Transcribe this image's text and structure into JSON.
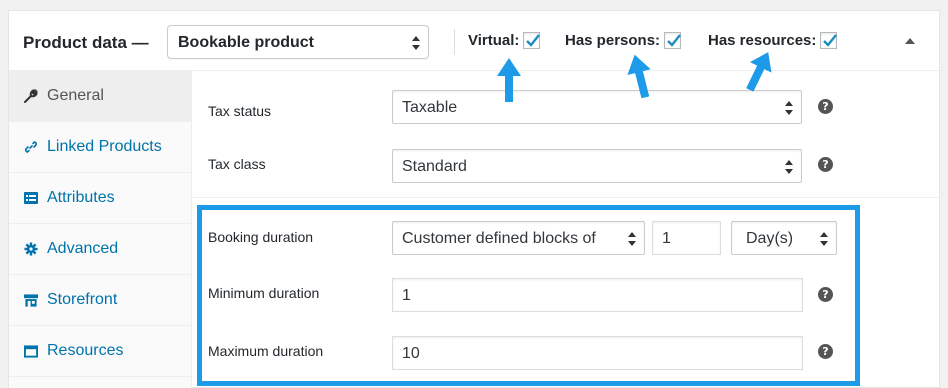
{
  "header": {
    "title": "Product data —",
    "product_type": "Bookable product",
    "options": [
      {
        "label": "Virtual:",
        "checked": true
      },
      {
        "label": "Has persons:",
        "checked": true
      },
      {
        "label": "Has resources:",
        "checked": true
      }
    ]
  },
  "sidebar": {
    "tabs": [
      {
        "label": "General",
        "icon": "wrench-icon",
        "active": true
      },
      {
        "label": "Linked Products",
        "icon": "link-icon",
        "active": false
      },
      {
        "label": "Attributes",
        "icon": "list-icon",
        "active": false
      },
      {
        "label": "Advanced",
        "icon": "gear-icon",
        "active": false
      },
      {
        "label": "Storefront",
        "icon": "store-icon",
        "active": false
      },
      {
        "label": "Resources",
        "icon": "window-icon",
        "active": false
      }
    ]
  },
  "general": {
    "tax_status": {
      "label": "Tax status",
      "value": "Taxable"
    },
    "tax_class": {
      "label": "Tax class",
      "value": "Standard"
    }
  },
  "booking": {
    "duration": {
      "label": "Booking duration",
      "type_value": "Customer defined blocks of",
      "amount": "1",
      "unit": "Day(s)"
    },
    "min_duration": {
      "label": "Minimum duration",
      "value": "1"
    },
    "max_duration": {
      "label": "Maximum duration",
      "value": "10"
    }
  },
  "colors": {
    "accent": "#1e9be8",
    "link": "#0073aa",
    "checkmark": "#1e8cbe"
  }
}
